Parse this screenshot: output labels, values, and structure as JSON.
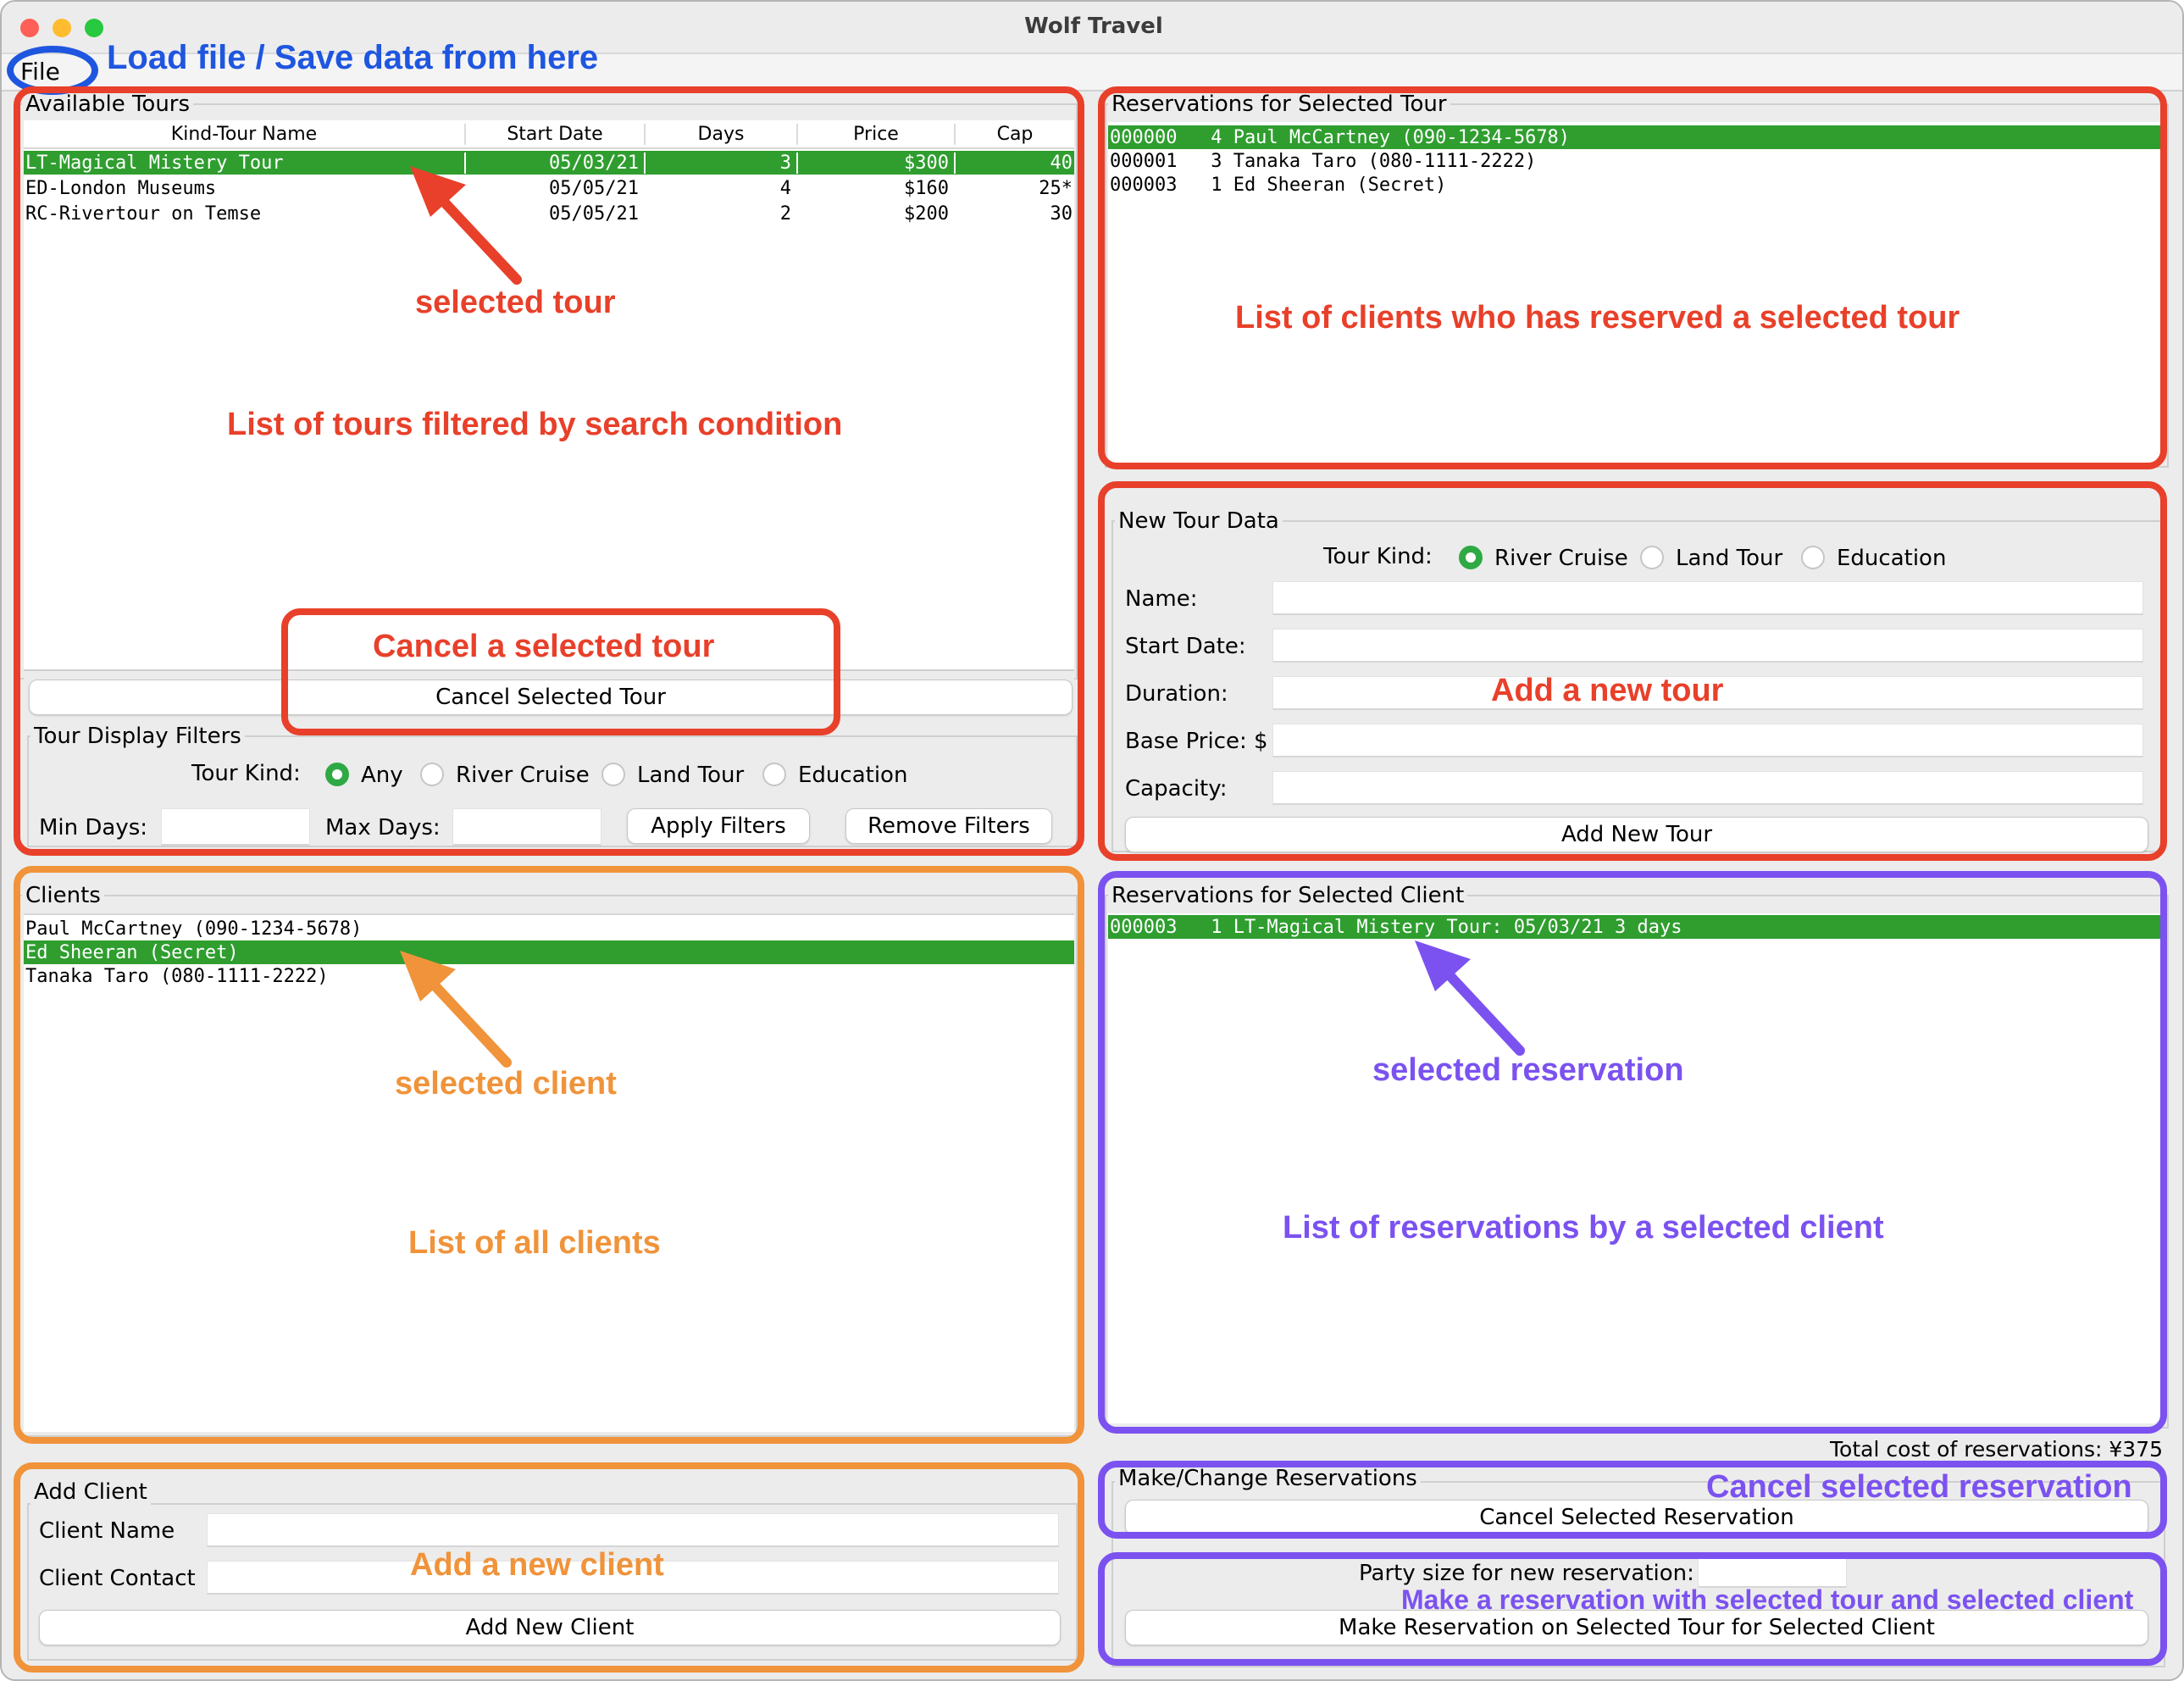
{
  "window": {
    "title": "Wolf Travel"
  },
  "menu": {
    "file": "File"
  },
  "available_tours": {
    "legend": "Available Tours",
    "columns": [
      "Kind-Tour Name",
      "Start Date",
      "Days",
      "Price",
      "Cap"
    ],
    "rows": [
      {
        "name": "LT-Magical Mistery Tour",
        "start": "05/03/21",
        "days": "3",
        "price": "$300",
        "cap": "40",
        "selected": true
      },
      {
        "name": "ED-London Museums",
        "start": "05/05/21",
        "days": "4",
        "price": "$160",
        "cap": "25*",
        "selected": false
      },
      {
        "name": "RC-Rivertour on Temse",
        "start": "05/05/21",
        "days": "2",
        "price": "$200",
        "cap": "30",
        "selected": false
      }
    ],
    "cancel_button": "Cancel Selected Tour"
  },
  "filters": {
    "legend": "Tour Display Filters",
    "kind_label": "Tour Kind:",
    "kinds": [
      "Any",
      "River Cruise",
      "Land Tour",
      "Education"
    ],
    "selected_kind": "Any",
    "min_days_label": "Min Days:",
    "max_days_label": "Max Days:",
    "min_days_value": "",
    "max_days_value": "",
    "apply_button": "Apply Filters",
    "remove_button": "Remove Filters"
  },
  "tour_reservations": {
    "legend": "Reservations for Selected Tour",
    "rows": [
      {
        "text": "000000   4 Paul McCartney (090-1234-5678)",
        "selected": true
      },
      {
        "text": "000001   3 Tanaka Taro (080-1111-2222)",
        "selected": false
      },
      {
        "text": "000003   1 Ed Sheeran (Secret)",
        "selected": false
      }
    ]
  },
  "new_tour": {
    "legend": "New Tour Data",
    "kind_label": "Tour Kind:",
    "kinds": [
      "River Cruise",
      "Land Tour",
      "Education"
    ],
    "selected_kind": "River Cruise",
    "name_label": "Name:",
    "start_label": "Start Date:",
    "duration_label": "Duration:",
    "price_label": "Base Price: $",
    "capacity_label": "Capacity:",
    "add_button": "Add New Tour"
  },
  "clients": {
    "legend": "Clients",
    "rows": [
      {
        "text": "Paul McCartney (090-1234-5678)",
        "selected": false
      },
      {
        "text": "Ed Sheeran (Secret)",
        "selected": true
      },
      {
        "text": "Tanaka Taro (080-1111-2222)",
        "selected": false
      }
    ]
  },
  "client_reservations": {
    "legend": "Reservations for Selected Client",
    "rows": [
      {
        "text": "000003   1 LT-Magical Mistery Tour: 05/03/21 3 days",
        "selected": true
      }
    ],
    "total_cost": "Total cost of reservations: ¥375"
  },
  "add_client": {
    "legend": "Add Client",
    "name_label": "Client Name",
    "contact_label": "Client Contact",
    "add_button": "Add New Client"
  },
  "make_change": {
    "legend": "Make/Change Reservations",
    "cancel_button": "Cancel Selected Reservation",
    "party_label": "Party size for new reservation:",
    "make_button": "Make Reservation on Selected Tour for Selected Client"
  },
  "annotations": {
    "file_note": "Load file / Save data from here",
    "selected_tour": "selected tour",
    "tour_list": "List of tours filtered by search condition",
    "cancel_tour": "Cancel a selected tour",
    "tour_clients": "List of clients who has reserved a selected tour",
    "add_tour": "Add a new tour",
    "selected_client": "selected client",
    "all_clients": "List of all clients",
    "add_client": "Add a new client",
    "selected_reservation": "selected reservation",
    "client_reservations": "List of reservations by a selected client",
    "cancel_reservation": "Cancel selected reservation",
    "make_reservation": "Make a reservation with selected tour and selected client"
  },
  "colors": {
    "selection_green": "#2f9e2f",
    "annotation_red": "#e8402a",
    "annotation_orange": "#f0933a",
    "annotation_purple": "#7b52f0",
    "annotation_blue": "#1f56e0"
  }
}
